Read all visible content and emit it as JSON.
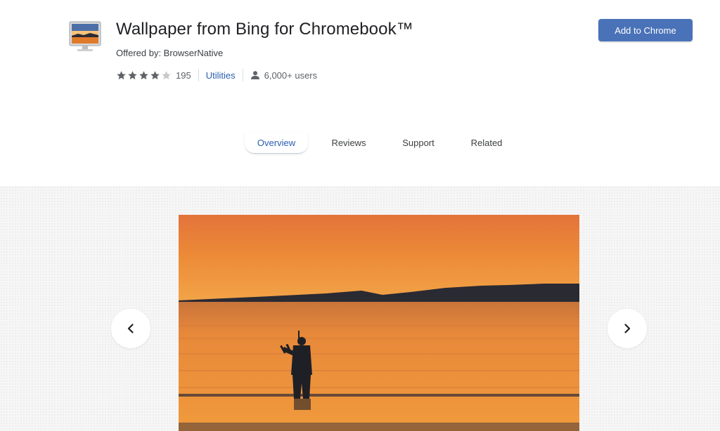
{
  "extension": {
    "title": "Wallpaper from Bing for Chromebook™",
    "offered_by": "Offered by: BrowserNative",
    "rating": 4,
    "rating_max": 5,
    "rating_count": "195",
    "category": "Utilities",
    "users": "6,000+ users"
  },
  "actions": {
    "add_label": "Add to Chrome"
  },
  "tabs": [
    {
      "label": "Overview",
      "active": true
    },
    {
      "label": "Reviews",
      "active": false
    },
    {
      "label": "Support",
      "active": false
    },
    {
      "label": "Related",
      "active": false
    }
  ],
  "gallery": {
    "image": "sunset-bagpiper-beach-screenshot",
    "prev_icon": "chevron-left-icon",
    "next_icon": "chevron-right-icon"
  },
  "colors": {
    "accent": "#4a72b8",
    "link": "#2a5db0",
    "star": "#5f6368"
  }
}
